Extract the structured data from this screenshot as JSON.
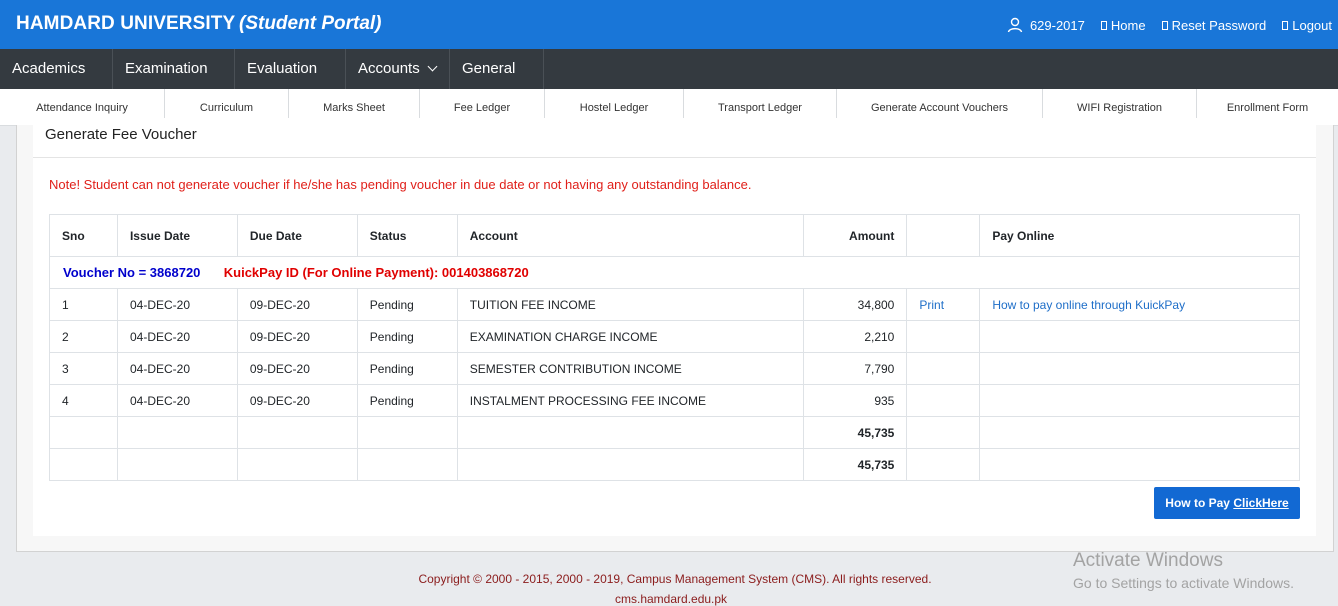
{
  "header": {
    "brand": "HAMDARD UNIVERSITY",
    "subtitle": "(Student Portal)",
    "user_id": "629-2017",
    "home": "Home",
    "reset_password": "Reset Password",
    "logout": "Logout"
  },
  "nav": [
    {
      "label": "Academics"
    },
    {
      "label": "Examination"
    },
    {
      "label": "Evaluation"
    },
    {
      "label": "Accounts"
    },
    {
      "label": "General"
    }
  ],
  "subtabs": [
    {
      "label": "Attendance Inquiry"
    },
    {
      "label": "Curriculum"
    },
    {
      "label": "Marks Sheet"
    },
    {
      "label": "Fee Ledger"
    },
    {
      "label": "Hostel Ledger"
    },
    {
      "label": "Transport Ledger"
    },
    {
      "label": "Generate Account Vouchers"
    },
    {
      "label": "WIFI Registration"
    },
    {
      "label": "Enrollment Form"
    }
  ],
  "page": {
    "title": "Generate Fee Voucher",
    "note": "Note! Student can not generate voucher if he/she has pending voucher in due date or not having any outstanding balance."
  },
  "table": {
    "headers": {
      "sno": "Sno",
      "issue_date": "Issue Date",
      "due_date": "Due Date",
      "status": "Status",
      "account": "Account",
      "amount": "Amount",
      "print": "",
      "pay_online": "Pay Online"
    },
    "voucher_no": "Voucher No = 3868720",
    "kuickpay_id": "KuickPay ID (For Online Payment): 001403868720",
    "rows": [
      {
        "sno": "1",
        "issue_date": "04-DEC-20",
        "due_date": "09-DEC-20",
        "status": "Pending",
        "account": "TUITION FEE INCOME",
        "amount": "34,800",
        "print": "Print",
        "pay_online": "How to pay online through KuickPay"
      },
      {
        "sno": "2",
        "issue_date": "04-DEC-20",
        "due_date": "09-DEC-20",
        "status": "Pending",
        "account": "EXAMINATION CHARGE INCOME",
        "amount": "2,210",
        "print": "",
        "pay_online": ""
      },
      {
        "sno": "3",
        "issue_date": "04-DEC-20",
        "due_date": "09-DEC-20",
        "status": "Pending",
        "account": "SEMESTER CONTRIBUTION INCOME",
        "amount": "7,790",
        "print": "",
        "pay_online": ""
      },
      {
        "sno": "4",
        "issue_date": "04-DEC-20",
        "due_date": "09-DEC-20",
        "status": "Pending",
        "account": "INSTALMENT PROCESSING FEE INCOME",
        "amount": "935",
        "print": "",
        "pay_online": ""
      }
    ],
    "subtotal": "45,735",
    "total": "45,735"
  },
  "pay_button": {
    "label": "How to Pay ",
    "link": "ClickHere"
  },
  "footer": {
    "copyright": "Copyright © 2000 - 2015, 2000 - 2019, Campus Management System (CMS). All rights reserved.",
    "site": "cms.hamdard.edu.pk"
  },
  "watermark": {
    "line1": "Activate Windows",
    "line2": "Go to Settings to activate Windows."
  },
  "colors": {
    "header_blue": "#1976d8",
    "nav_dark": "#343a40",
    "note_red": "#e0201a",
    "voucher_blue": "#0000cc",
    "button_blue": "#1269d3"
  }
}
